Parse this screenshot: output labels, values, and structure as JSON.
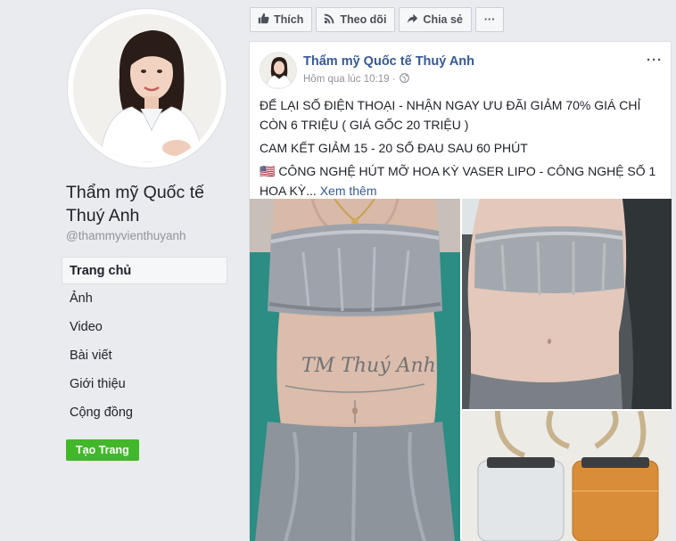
{
  "sidebar": {
    "page_name": "Thẩm mỹ Quốc tế Thuý Anh",
    "handle": "@thammyvienthuyanh",
    "nav": [
      {
        "label": "Trang chủ",
        "active": true
      },
      {
        "label": "Ảnh"
      },
      {
        "label": "Video"
      },
      {
        "label": "Bài viết"
      },
      {
        "label": "Giới thiệu"
      },
      {
        "label": "Cộng đồng"
      }
    ],
    "create_page_label": "Tạo Trang"
  },
  "actions": {
    "like": "Thích",
    "follow": "Theo dõi",
    "share": "Chia sẻ",
    "more": "···"
  },
  "post": {
    "author": "Thẩm mỹ Quốc tế Thuý Anh",
    "timestamp": "Hôm qua lúc 10:19 ·",
    "more": "···",
    "lines": [
      "ĐỂ LẠI SỐ ĐIỆN THOẠI - NHẬN NGAY ƯU ĐÃI GIẢM 70% GIÁ CHỈ CÒN 6 TRIỆU ( GIÁ GỐC 20 TRIỆU )",
      "CAM KẾT GIẢM 15 - 20 SỐ ĐAU SAU 60 PHÚT",
      "🇺🇸 CÔNG NGHỆ HÚT MỠ HOA KỲ VASER LIPO - CÔNG NGHỆ SỐ 1 HOA KỲ..."
    ],
    "see_more": "Xem thêm",
    "photo_handwriting": "TM Thuý Anh"
  },
  "colors": {
    "link": "#365899",
    "create_button": "#42b72a",
    "background": "#e9ebee"
  }
}
